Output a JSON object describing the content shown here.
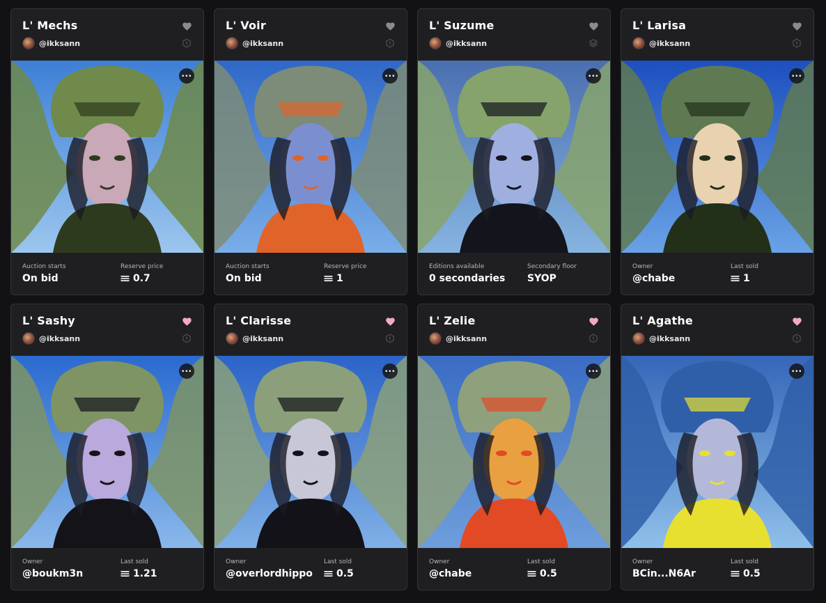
{
  "colors": {
    "heart_inactive": "#8a8a90",
    "heart_active": "#f4a8c8",
    "card_bg": "#1f1f22",
    "page_bg": "#121214"
  },
  "cards": [
    {
      "title": "L' Mechs",
      "creator": "@ikksann",
      "liked": false,
      "edition_icon": "single-edition-icon",
      "stat1_label": "Auction starts",
      "stat1_value": "On bid",
      "stat2_label": "Reserve price",
      "stat2_value": "0.7",
      "stat2_eth": true,
      "art": {
        "sky": "#3d7fd6",
        "sky2": "#9cc6ee",
        "subject": "#6f8a4a",
        "accent": "#2e3a1e",
        "face": "#c9a8b8"
      }
    },
    {
      "title": "L' Voir",
      "creator": "@ikksann",
      "liked": false,
      "edition_icon": "single-edition-icon",
      "stat1_label": "Auction starts",
      "stat1_value": "On bid",
      "stat2_label": "Reserve price",
      "stat2_value": "1",
      "stat2_eth": true,
      "art": {
        "sky": "#2f68c8",
        "sky2": "#7aaee8",
        "subject": "#7c8c78",
        "accent": "#e0642a",
        "face": "#7b8fd0"
      }
    },
    {
      "title": "L' Suzume",
      "creator": "@ikksann",
      "liked": false,
      "edition_icon": "multi-edition-icon",
      "stat1_label": "Editions available",
      "stat1_value": "0 secondaries",
      "stat2_label": "Secondary floor",
      "stat2_value": "SYOP",
      "stat2_eth": false,
      "art": {
        "sky": "#4a6fb0",
        "sky2": "#86b4e0",
        "subject": "#87a36c",
        "accent": "#14141c",
        "face": "#9fb0e0"
      }
    },
    {
      "title": "L' Larisa",
      "creator": "@ikksann",
      "liked": false,
      "edition_icon": "single-edition-icon",
      "stat1_label": "Owner",
      "stat1_value": "@chabe",
      "stat2_label": "Last sold",
      "stat2_value": "1",
      "stat2_eth": true,
      "art": {
        "sky": "#1d4fbf",
        "sky2": "#6aa2e6",
        "subject": "#5f7a52",
        "accent": "#22301a",
        "face": "#e9d2b0"
      }
    },
    {
      "title": "L' Sashy",
      "creator": "@ikksann",
      "liked": true,
      "edition_icon": "single-edition-icon",
      "stat1_label": "Owner",
      "stat1_value": "@boukm3n",
      "stat2_label": "Last sold",
      "stat2_value": "1.21",
      "stat2_eth": true,
      "art": {
        "sky": "#2a6ad0",
        "sky2": "#8ab8ea",
        "subject": "#7e9464",
        "accent": "#141418",
        "face": "#b9a9dc"
      }
    },
    {
      "title": "L' Clarisse",
      "creator": "@ikksann",
      "liked": true,
      "edition_icon": "single-edition-icon",
      "stat1_label": "Owner",
      "stat1_value": "@overlordhippo",
      "stat2_label": "Last sold",
      "stat2_value": "0.5",
      "stat2_eth": true,
      "art": {
        "sky": "#2b63c8",
        "sky2": "#80b0e6",
        "subject": "#8ba07a",
        "accent": "#121218",
        "face": "#c7c7d8"
      }
    },
    {
      "title": "L' Zelie",
      "creator": "@ikksann",
      "liked": true,
      "edition_icon": "single-edition-icon",
      "stat1_label": "Owner",
      "stat1_value": "@chabe",
      "stat2_label": "Last sold",
      "stat2_value": "0.5",
      "stat2_eth": true,
      "art": {
        "sky": "#3a6cc4",
        "sky2": "#6f9edc",
        "subject": "#8ea07c",
        "accent": "#e24a26",
        "face": "#e8a040"
      }
    },
    {
      "title": "L' Agathe",
      "creator": "@ikksann",
      "liked": true,
      "edition_icon": "single-edition-icon",
      "stat1_label": "Owner",
      "stat1_value": "BCin...N6Ar",
      "stat2_label": "Last sold",
      "stat2_value": "0.5",
      "stat2_eth": true,
      "art": {
        "sky": "#3566b8",
        "sky2": "#8fc0ea",
        "subject": "#2f5fa8",
        "accent": "#e8e030",
        "face": "#b4b8d8"
      }
    }
  ]
}
